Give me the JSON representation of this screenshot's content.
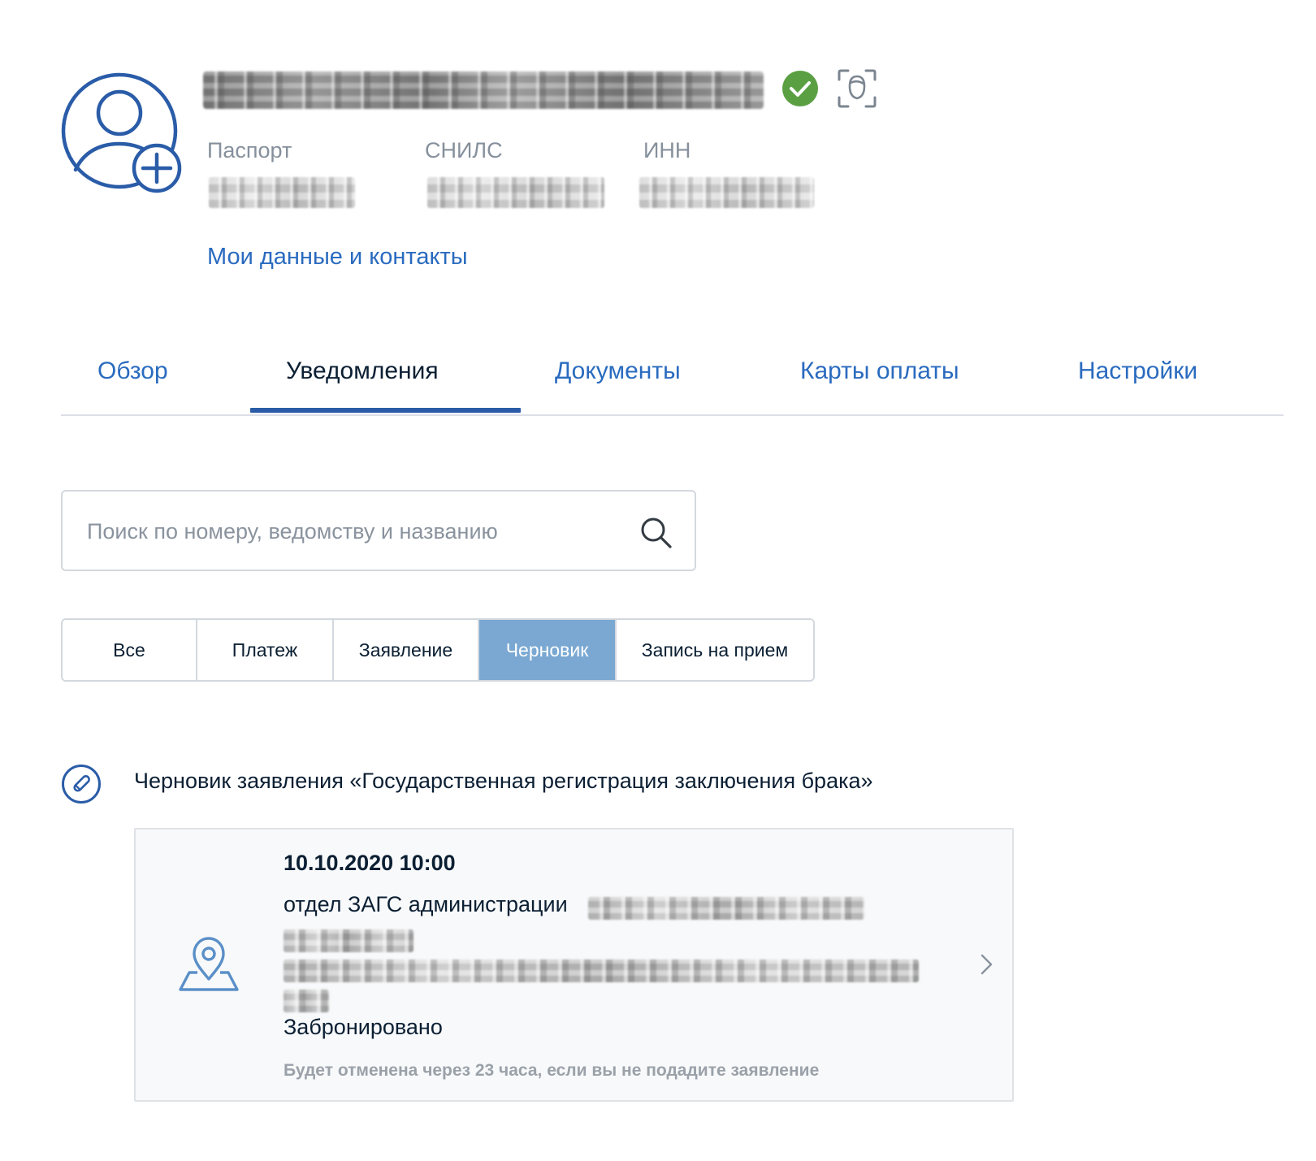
{
  "profile": {
    "documents": [
      {
        "label": "Паспорт"
      },
      {
        "label": "СНИЛС"
      },
      {
        "label": "ИНН"
      }
    ],
    "contacts_link": "Мои данные и контакты"
  },
  "tabs": [
    {
      "label": "Обзор"
    },
    {
      "label": "Уведомления",
      "active": true
    },
    {
      "label": "Документы"
    },
    {
      "label": "Карты оплаты"
    },
    {
      "label": "Настройки"
    }
  ],
  "search": {
    "placeholder": "Поиск по номеру, ведомству и названию",
    "value": ""
  },
  "filters": [
    {
      "label": "Все"
    },
    {
      "label": "Платеж"
    },
    {
      "label": "Заявление"
    },
    {
      "label": "Черновик",
      "selected": true
    },
    {
      "label": "Запись на прием"
    }
  ],
  "notification": {
    "title": "Черновик заявления «Государственная регистрация заключения брака»",
    "card": {
      "datetime": "10.10.2020 10:00",
      "org": "отдел ЗАГС администрации",
      "status": "Забронировано",
      "note": "Будет отменена через 23 часа, если вы не подадите заявление"
    }
  },
  "colors": {
    "link_blue": "#2a6bbf",
    "tab_underline": "#2a5ca8",
    "selected_filter": "#7aa8d2",
    "verified_green": "#5aa043",
    "text_dark": "#0b1f33",
    "text_muted": "#86909c"
  },
  "icons": [
    "avatar-add-icon",
    "verified-check-icon",
    "face-id-icon",
    "search-icon",
    "draft-pencil-icon",
    "map-pin-icon",
    "chevron-right-icon"
  ]
}
